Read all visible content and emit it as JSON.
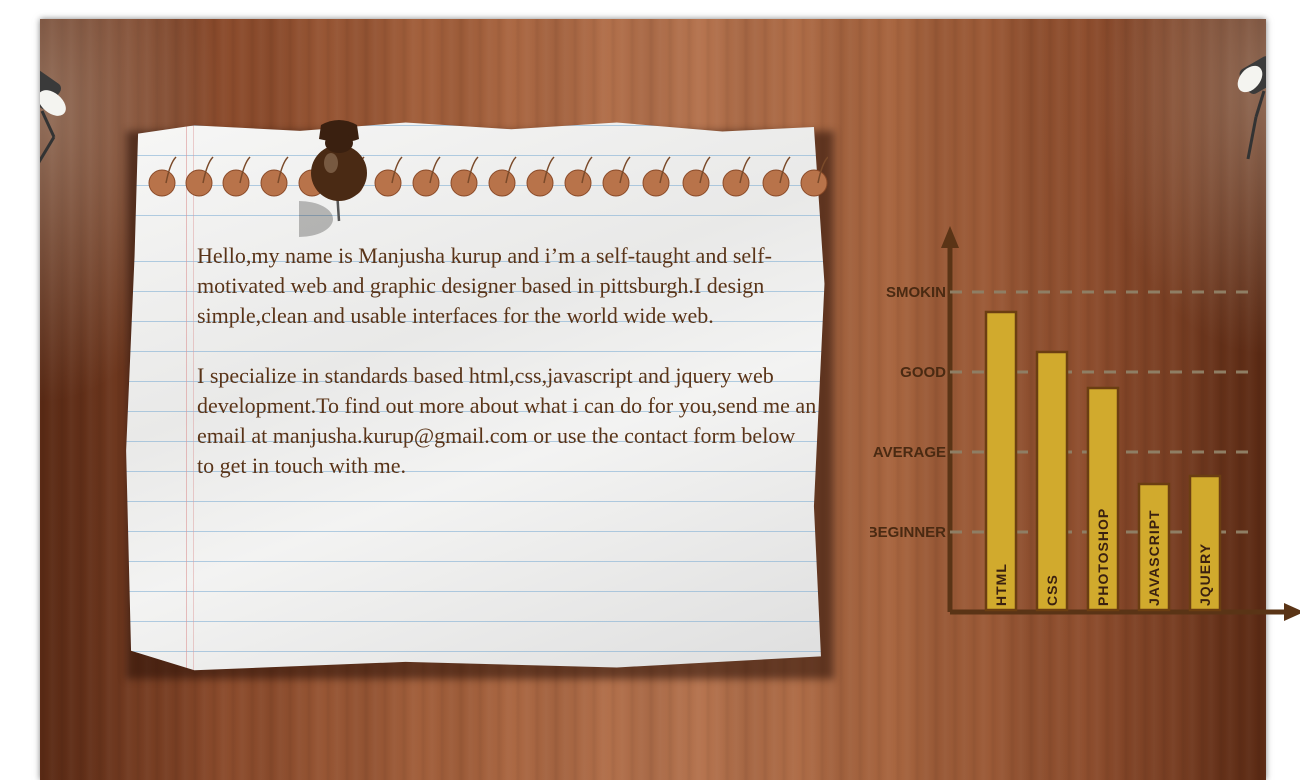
{
  "intro": {
    "paragraph_1": "Hello,my name is Manjusha kurup and i’m a self-taught and self-motivated web and graphic designer based in pittsburgh.I design simple,clean and usable interfaces for the world wide web.",
    "paragraph_2": "I specialize in standards based html,css,javascript and jquery web development.To find out more about what i can do for you,send me an email at manjusha.kurup@gmail.com or use the contact form below to get in touch with me."
  },
  "colors": {
    "text": "#5a3418",
    "bar_fill": "#d1aa2d",
    "bar_stroke": "#6b3e12",
    "axis": "#5a3416",
    "grid": "#8f7e64"
  },
  "chart_data": {
    "type": "bar",
    "categories": [
      "HTML",
      "CSS",
      "PHOTOSHOP",
      "JAVASCRIPT",
      "JQUERY"
    ],
    "values": [
      3.75,
      3.25,
      2.8,
      1.6,
      1.7
    ],
    "levels": [
      {
        "label": "BEGINNER",
        "value": 1
      },
      {
        "label": "AVERAGE",
        "value": 2
      },
      {
        "label": "GOOD",
        "value": 3
      },
      {
        "label": "SMOKIN",
        "value": 4
      }
    ],
    "ylim": [
      0,
      4.6
    ],
    "grid": true
  }
}
